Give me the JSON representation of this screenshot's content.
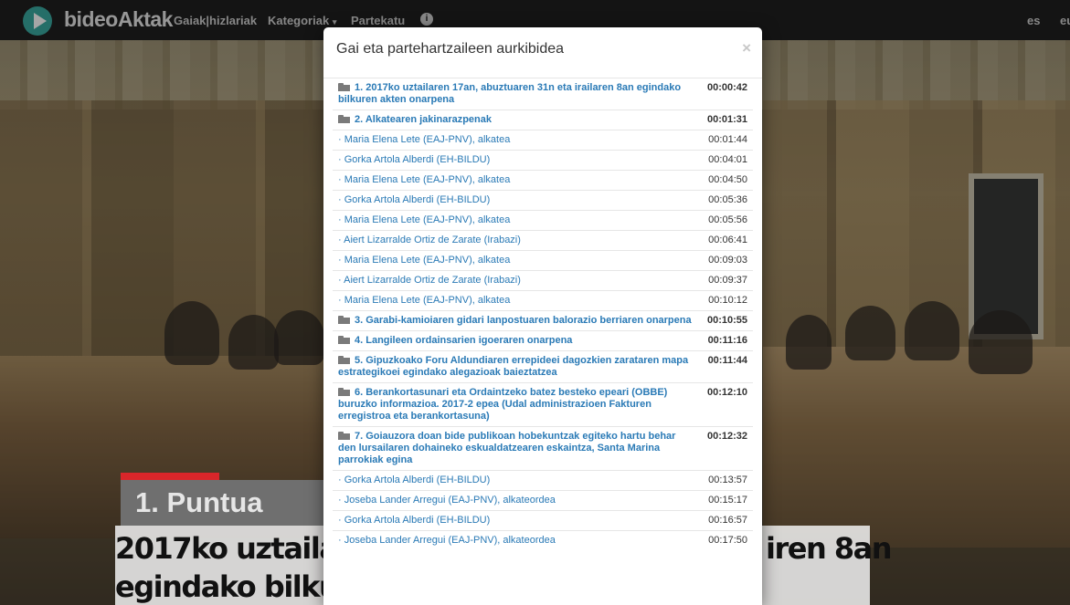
{
  "navbar": {
    "brand": "bideoAktak",
    "items": [
      "Gaiak|hizlariak",
      "Kategoriak",
      "Partekatu"
    ],
    "lang": [
      "es",
      "eu"
    ]
  },
  "caption": {
    "point": "1. Puntua",
    "line1": "2017ko uztailar",
    "line1_right": "iren 8an",
    "line2": "egindako bilkur"
  },
  "modal": {
    "title": "Gai eta partehartzaileen aurkibidea",
    "close": "×",
    "rows": [
      {
        "type": "topic",
        "title": "1. 2017ko uztailaren 17an, abuztuaren 31n eta irailaren 8an egindako bilkuren akten onarpena",
        "time": "00:00:42"
      },
      {
        "type": "topic",
        "title": "2. Alkatearen jakinarazpenak",
        "time": "00:01:31"
      },
      {
        "type": "speaker",
        "title": "Maria Elena Lete (EAJ-PNV), alkatea",
        "time": "00:01:44"
      },
      {
        "type": "speaker",
        "title": "Gorka Artola Alberdi (EH-BILDU)",
        "time": "00:04:01"
      },
      {
        "type": "speaker",
        "title": "Maria Elena Lete (EAJ-PNV), alkatea",
        "time": "00:04:50"
      },
      {
        "type": "speaker",
        "title": "Gorka Artola Alberdi (EH-BILDU)",
        "time": "00:05:36"
      },
      {
        "type": "speaker",
        "title": "Maria Elena Lete (EAJ-PNV), alkatea",
        "time": "00:05:56"
      },
      {
        "type": "speaker",
        "title": "Aiert Lizarralde Ortiz de Zarate (Irabazi)",
        "time": "00:06:41"
      },
      {
        "type": "speaker",
        "title": "Maria Elena Lete (EAJ-PNV), alkatea",
        "time": "00:09:03"
      },
      {
        "type": "speaker",
        "title": "Aiert Lizarralde Ortiz de Zarate (Irabazi)",
        "time": "00:09:37"
      },
      {
        "type": "speaker",
        "title": "Maria Elena Lete (EAJ-PNV), alkatea",
        "time": "00:10:12"
      },
      {
        "type": "topic",
        "title": "3. Garabi-kamioiaren gidari lanpostuaren balorazio berriaren onarpena",
        "time": "00:10:55"
      },
      {
        "type": "topic",
        "title": "4. Langileen ordainsarien igoeraren onarpena",
        "time": "00:11:16"
      },
      {
        "type": "topic",
        "title": "5. Gipuzkoako Foru Aldundiaren errepideei dagozkien zarataren mapa estrategikoei egindako alegazioak baieztatzea",
        "time": "00:11:44"
      },
      {
        "type": "topic",
        "title": "6. Berankortasunari eta Ordaintzeko batez besteko epeari (OBBE) buruzko informazioa. 2017-2 epea (Udal administrazioen Fakturen erregistroa eta berankortasuna)",
        "time": "00:12:10"
      },
      {
        "type": "topic",
        "title": "7. Goiauzora doan bide publikoan hobekuntzak egiteko hartu behar den lursailaren dohaineko eskualdatzearen eskaintza, Santa Marina parrokiak egina",
        "time": "00:12:32"
      },
      {
        "type": "speaker",
        "title": "Gorka Artola Alberdi (EH-BILDU)",
        "time": "00:13:57"
      },
      {
        "type": "speaker",
        "title": "Joseba Lander Arregui (EAJ-PNV), alkateordea",
        "time": "00:15:17"
      },
      {
        "type": "speaker",
        "title": "Gorka Artola Alberdi (EH-BILDU)",
        "time": "00:16:57"
      },
      {
        "type": "speaker",
        "title": "Joseba Lander Arregui (EAJ-PNV), alkateordea",
        "time": "00:17:50"
      }
    ]
  }
}
